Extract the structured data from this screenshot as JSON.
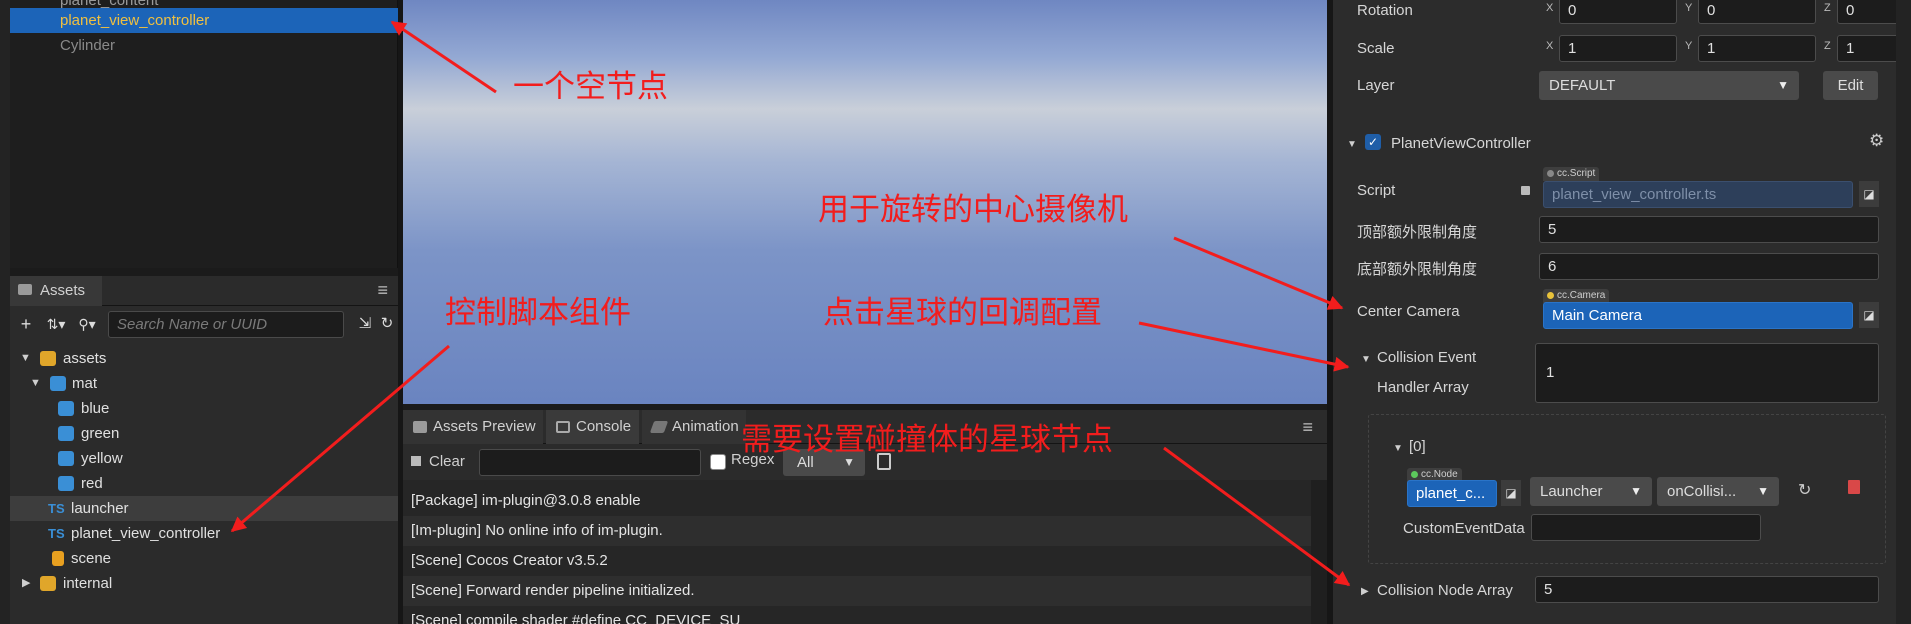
{
  "hierarchy": {
    "items": [
      {
        "label": "planet_content"
      },
      {
        "label": "planet_view_controller"
      },
      {
        "label": "Cylinder"
      }
    ]
  },
  "assets": {
    "tab_label": "Assets",
    "search_placeholder": "Search Name or UUID",
    "tree": [
      {
        "label": "assets",
        "icon": "database-icon"
      },
      {
        "label": "mat",
        "icon": "folder-icon"
      },
      {
        "label": "blue",
        "icon": "material-icon"
      },
      {
        "label": "green",
        "icon": "material-icon"
      },
      {
        "label": "yellow",
        "icon": "material-icon"
      },
      {
        "label": "red",
        "icon": "material-icon"
      },
      {
        "label": "launcher",
        "icon": "ts-icon",
        "badge": "TS"
      },
      {
        "label": "planet_view_controller",
        "icon": "ts-icon",
        "badge": "TS"
      },
      {
        "label": "scene",
        "icon": "scene-icon"
      },
      {
        "label": "internal",
        "icon": "database-icon"
      }
    ]
  },
  "bottom_panel": {
    "tabs": [
      {
        "label": "Assets Preview"
      },
      {
        "label": "Console"
      },
      {
        "label": "Animation"
      }
    ],
    "clear_label": "Clear",
    "regex_label": "Regex",
    "level_value": "All",
    "logs": [
      "[Package] im-plugin@3.0.8 enable",
      "[Im-plugin] No online info of im-plugin.",
      "[Scene] Cocos Creator v3.5.2",
      "[Scene] Forward render pipeline initialized.",
      "[Scene] compile shader #define CC_DEVICE_SU"
    ]
  },
  "inspector": {
    "rotation": {
      "label": "Rotation",
      "x": "0",
      "y": "0",
      "z": "0"
    },
    "scale": {
      "label": "Scale",
      "x": "1",
      "y": "1",
      "z": "1"
    },
    "axes": {
      "x": "X",
      "y": "Y",
      "z": "Z"
    },
    "layer": {
      "label": "Layer",
      "value": "DEFAULT",
      "edit_label": "Edit"
    },
    "component": {
      "name": "PlanetViewController",
      "script_label": "Script",
      "script_tag": "cc.Script",
      "script_value": "planet_view_controller.ts",
      "top_angle_label": "顶部额外限制角度",
      "top_angle_value": "5",
      "bottom_angle_label": "底部额外限制角度",
      "bottom_angle_value": "6",
      "center_camera_label": "Center Camera",
      "center_camera_tag": "cc.Camera",
      "center_camera_value": "Main Camera",
      "collision_event_label": "Collision Event",
      "collision_event_label_2": "Handler Array",
      "collision_event_count": "1",
      "item_index": "[0]",
      "node_tag": "cc.Node",
      "node_value": "planet_c...",
      "component_value": "Launcher",
      "handler_value": "onCollisi...",
      "custom_event_label": "CustomEventData",
      "custom_event_value": "",
      "collision_node_label": "Collision Node Array",
      "collision_node_count": "5"
    }
  },
  "annotations": {
    "empty_node": "一个空节点",
    "control_script": "控制脚本组件",
    "center_camera": "用于旋转的中心摄像机",
    "callback": "点击星球的回调配置",
    "collision_nodes": "需要设置碰撞体的星球节点"
  },
  "colors": {
    "selection": "#1c64b8",
    "annotation": "#f21d1d",
    "accent_text": "#f0c040"
  }
}
